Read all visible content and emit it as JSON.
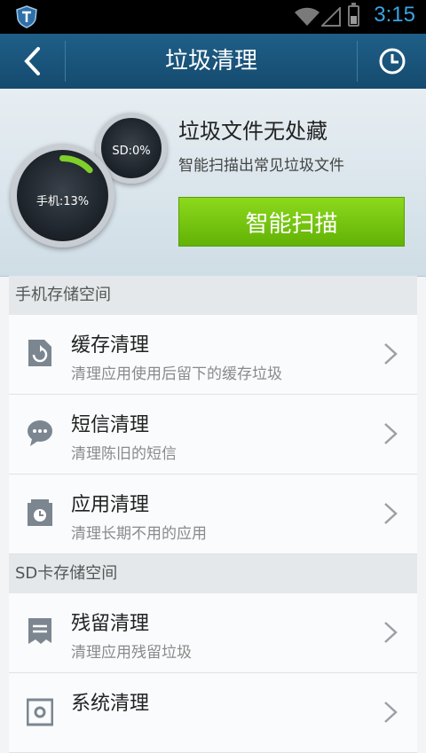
{
  "status": {
    "time": "3:15"
  },
  "header": {
    "title": "垃圾清理",
    "back_icon": "chevron-left-icon",
    "history_icon": "clock-history-icon"
  },
  "storage": {
    "phone_label": "手机:13%",
    "phone_percent": 13,
    "sd_label": "SD:0%",
    "sd_percent": 0
  },
  "hero": {
    "title": "垃圾文件无处藏",
    "subtitle": "智能扫描出常见垃圾文件",
    "scan_button": "智能扫描"
  },
  "sections": [
    {
      "title": "手机存储空间",
      "items": [
        {
          "title": "缓存清理",
          "subtitle": "清理应用使用后留下的缓存垃圾",
          "icon": "cache-refresh-icon"
        },
        {
          "title": "短信清理",
          "subtitle": "清理陈旧的短信",
          "icon": "chat-bubble-icon"
        },
        {
          "title": "应用清理",
          "subtitle": "清理长期不用的应用",
          "icon": "app-box-icon"
        }
      ]
    },
    {
      "title": "SD卡存储空间",
      "items": [
        {
          "title": "残留清理",
          "subtitle": "清理应用残留垃圾",
          "icon": "residual-doc-icon"
        },
        {
          "title": "系统清理",
          "subtitle": "",
          "icon": "system-gear-icon"
        }
      ]
    }
  ],
  "colors": {
    "header": "#1a5880",
    "accent": "#3aa3e3",
    "button": "#74c50f"
  }
}
